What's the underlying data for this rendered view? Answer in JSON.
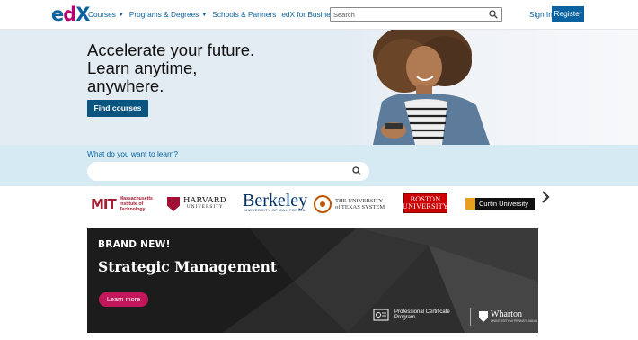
{
  "header": {
    "logo": {
      "e": "e",
      "d": "d",
      "x": "X"
    },
    "nav": [
      {
        "label": "Courses",
        "has_caret": true
      },
      {
        "label": "Programs & Degrees",
        "has_caret": true
      },
      {
        "label": "Schools & Partners",
        "has_caret": false
      },
      {
        "label": "edX for Business",
        "has_caret": false
      }
    ],
    "search_placeholder": "Search",
    "sign_in": "Sign In",
    "register": "Register"
  },
  "hero": {
    "title": "Accelerate your future. Learn anytime, anywhere.",
    "cta": "Find courses"
  },
  "learn": {
    "label": "What do you want to learn?",
    "placeholder": ""
  },
  "partners": {
    "mit": {
      "mark": "MIT",
      "text": "Massachusetts Institute of Technology"
    },
    "harvard": {
      "name": "HARVARD",
      "sub": "UNIVERSITY"
    },
    "berkeley": {
      "name": "Berkeley",
      "sub": "UNIVERSITY OF CALIFORNIA"
    },
    "texas": {
      "text": "THE UNIVERSITY of TEXAS SYSTEM"
    },
    "bu": {
      "line1": "BOSTON",
      "line2": "UNIVERSITY"
    },
    "curtin": {
      "text": "Curtin University"
    }
  },
  "banner": {
    "kicker": "BRAND NEW!",
    "title": "Strategic Management",
    "cta": "Learn more",
    "cert_text": "Professional Certificate Program",
    "wharton": "Wharton",
    "wharton_sub": "UNIVERSITY of PENNSYLVANIA"
  },
  "colors": {
    "brand_blue": "#0a63a0",
    "brand_magenta": "#b6006f",
    "cta_dark_blue": "#0a5580",
    "hero_bg": "#e3ebf3",
    "learn_bg": "#d5eaf2",
    "learn_more_pink": "#c2185b"
  },
  "icons": {
    "search": "search-icon",
    "next": "chevron-right-icon",
    "certificate": "certificate-icon"
  }
}
